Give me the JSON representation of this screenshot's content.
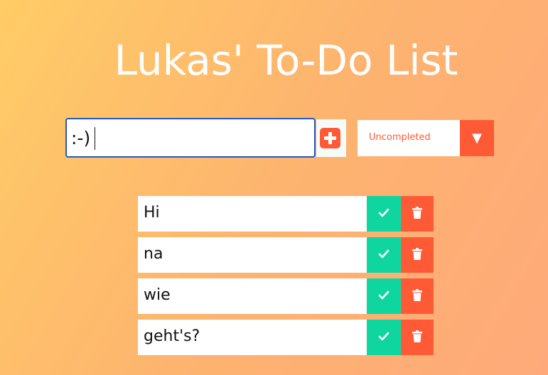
{
  "header": {
    "title": "Lukas' To-Do List"
  },
  "form": {
    "input_value": ":-)",
    "add_icon": "plus-icon",
    "filter": {
      "selected": "Uncompleted",
      "arrow_glyph": "▼"
    }
  },
  "todos": [
    {
      "text": "Hi"
    },
    {
      "text": "na"
    },
    {
      "text": "wie"
    },
    {
      "text": "geht's?"
    }
  ],
  "colors": {
    "accent": "#ff5a36",
    "complete": "#0fd69e",
    "text": "#111111",
    "title": "#ffffff"
  }
}
